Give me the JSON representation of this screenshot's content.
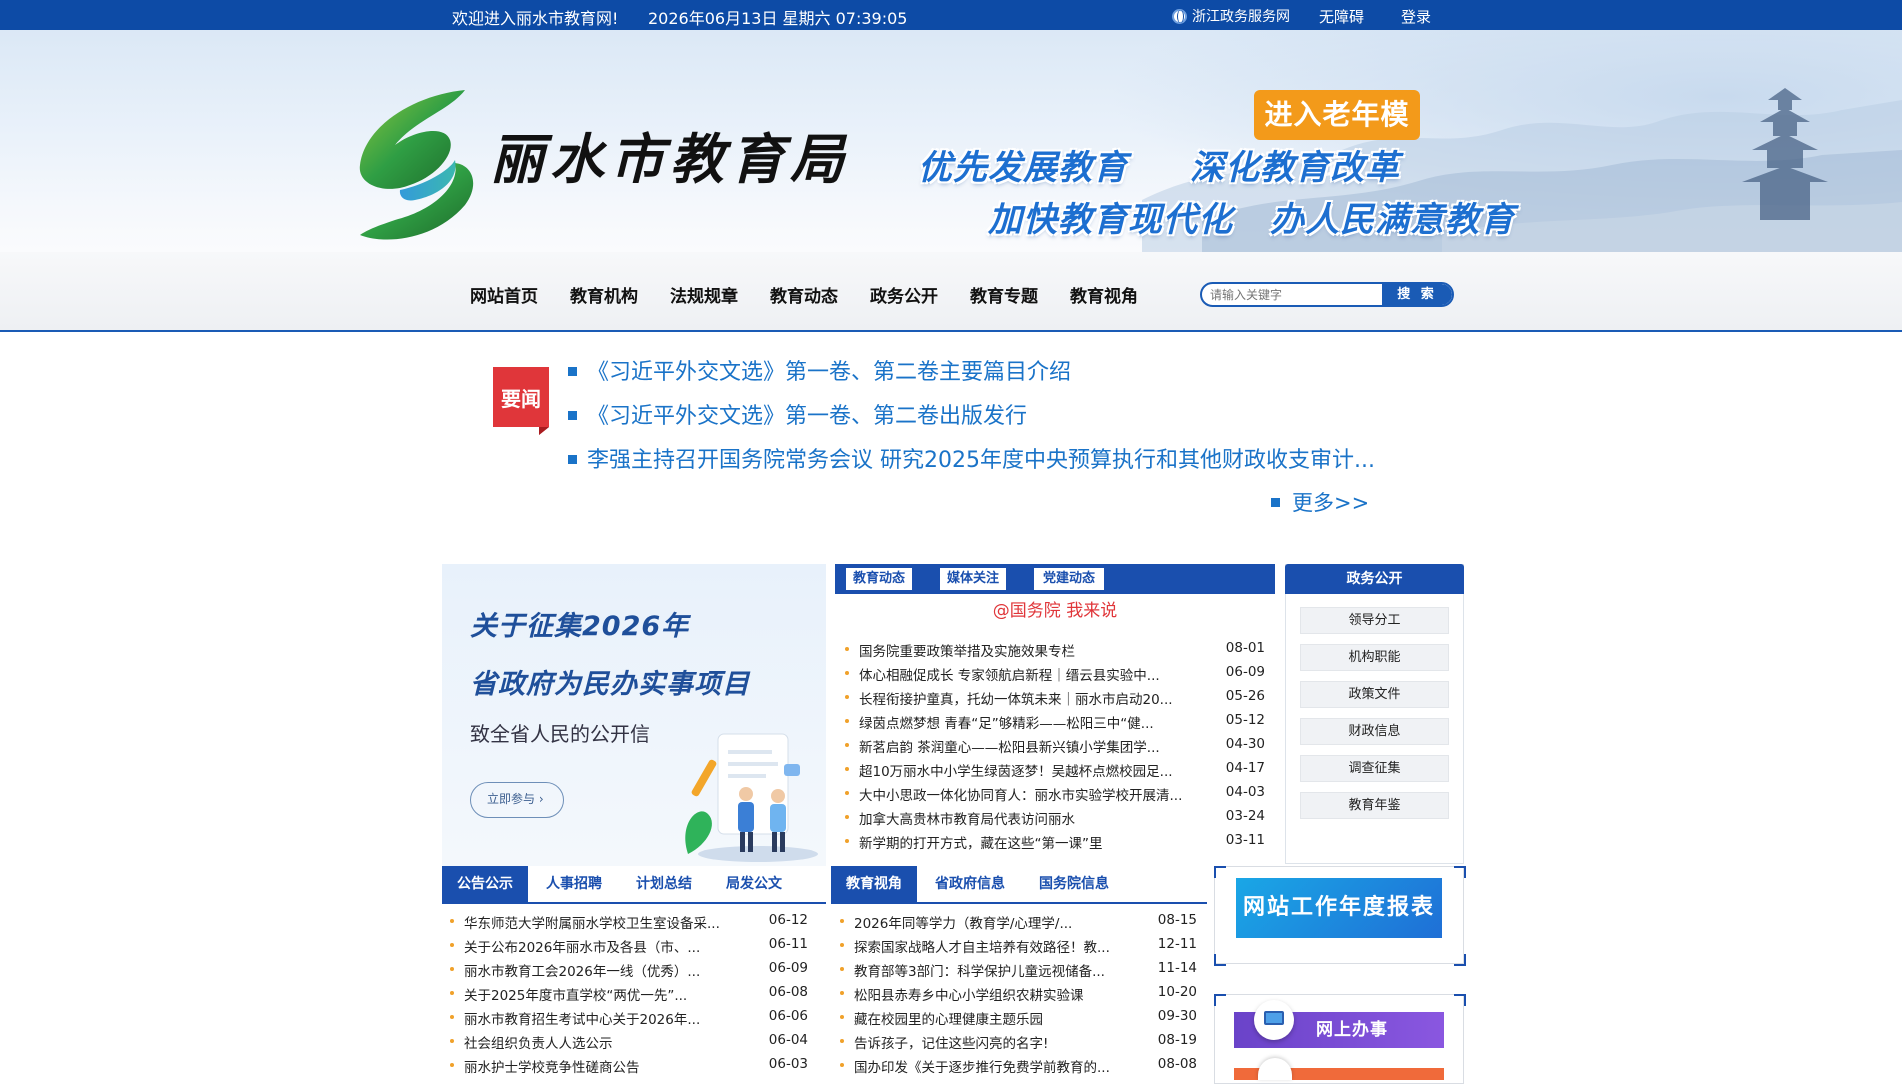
{
  "topbar": {
    "welcome": "欢迎进入丽水市教育网!",
    "datetime": "2026年06月13日 星期六 07:39:05",
    "zj_service": "浙江政务服务网",
    "accessibility": "无障碍",
    "login": "登录"
  },
  "banner": {
    "logo_text": "丽水市教育局",
    "elder_mode": "进入老年模式",
    "slogans": [
      "优先发展教育",
      "深化教育改革",
      "加快教育现代化",
      "办人民满意教育"
    ]
  },
  "nav": {
    "items": [
      "网站首页",
      "教育机构",
      "法规规章",
      "教育动态",
      "政务公开",
      "教育专题",
      "教育视角"
    ],
    "search_placeholder": "请输入关键字",
    "search_button": "搜 索"
  },
  "headlines": {
    "badge": "要闻",
    "items": [
      "《习近平外交文选》第一卷、第二卷主要篇目介绍",
      "《习近平外交文选》第一卷、第二卷出版发行",
      "李强主持召开国务院常务会议 研究2025年度中央预算执行和其他财政收支审计..."
    ],
    "more": "更多>>"
  },
  "promo": {
    "title1": "关于征集2026年",
    "title2": "省政府为民办实事项目",
    "subtitle": "致全省人民的公开信",
    "join": "立即参与"
  },
  "news_panel": {
    "tabs": [
      "教育动态",
      "媒体关注",
      "党建动态"
    ],
    "subtitle": "@国务院 我来说",
    "items": [
      {
        "title": "国务院重要政策举措及实施效果专栏",
        "date": "08-01"
      },
      {
        "title": "体心相融促成长 专家领航启新程｜缙云县实验中...",
        "date": "06-09"
      },
      {
        "title": "长程衔接护童真，托幼一体筑未来｜丽水市启动20...",
        "date": "05-26"
      },
      {
        "title": "绿茵点燃梦想 青春“足”够精彩——松阳三中“健...",
        "date": "05-12"
      },
      {
        "title": "新茗启韵 茶润童心——松阳县新兴镇小学集团学...",
        "date": "04-30"
      },
      {
        "title": "超10万丽水中小学生绿茵逐梦！吴越杯点燃校园足...",
        "date": "04-17"
      },
      {
        "title": "大中小思政一体化协同育人：丽水市实验学校开展清...",
        "date": "04-03"
      },
      {
        "title": "加拿大高贵林市教育局代表访问丽水",
        "date": "03-24"
      },
      {
        "title": "新学期的打开方式，藏在这些“第一课”里",
        "date": "03-11"
      }
    ]
  },
  "gov_panel": {
    "title": "政务公开",
    "items": [
      "领导分工",
      "机构职能",
      "政策文件",
      "财政信息",
      "调查征集",
      "教育年鉴"
    ]
  },
  "notice_panel": {
    "tabs": [
      "公告公示",
      "人事招聘",
      "计划总结",
      "局发公文"
    ],
    "items": [
      {
        "title": "华东师范大学附属丽水学校卫生室设备采...",
        "date": "06-12"
      },
      {
        "title": "关于公布2026年丽水市及各县（市、...",
        "date": "06-11"
      },
      {
        "title": "丽水市教育工会2026年一线（优秀）...",
        "date": "06-09"
      },
      {
        "title": "关于2025年度市直学校“两优一先”...",
        "date": "06-08"
      },
      {
        "title": "丽水市教育招生考试中心关于2026年...",
        "date": "06-06"
      },
      {
        "title": "社会组织负责人人选公示",
        "date": "06-04"
      },
      {
        "title": "丽水护士学校竞争性磋商公告",
        "date": "06-03"
      }
    ]
  },
  "view_panel": {
    "tabs": [
      "教育视角",
      "省政府信息",
      "国务院信息"
    ],
    "items": [
      {
        "title": "2026年同等学力（教育学/心理学/...",
        "date": "08-15"
      },
      {
        "title": "探索国家战略人才自主培养有效路径！教...",
        "date": "12-11"
      },
      {
        "title": "教育部等3部门：科学保护儿童远视储备...",
        "date": "11-14"
      },
      {
        "title": "松阳县赤寿乡中心小学组织农耕实验课",
        "date": "10-20"
      },
      {
        "title": "藏在校园里的心理健康主题乐园",
        "date": "09-30"
      },
      {
        "title": "告诉孩子，记住这些闪亮的名字!",
        "date": "08-19"
      },
      {
        "title": "国办印发《关于逐步推行免费学前教育的...",
        "date": "08-08"
      }
    ]
  },
  "right_links": {
    "report": "网站工作年度报表",
    "office": "网上办事"
  },
  "colors": {
    "topbar": "#0d4ba6",
    "primary": "#1a4fae",
    "link": "#1a73c8",
    "elder_button": "#f39a1a",
    "badge_red": "#e0363a"
  }
}
